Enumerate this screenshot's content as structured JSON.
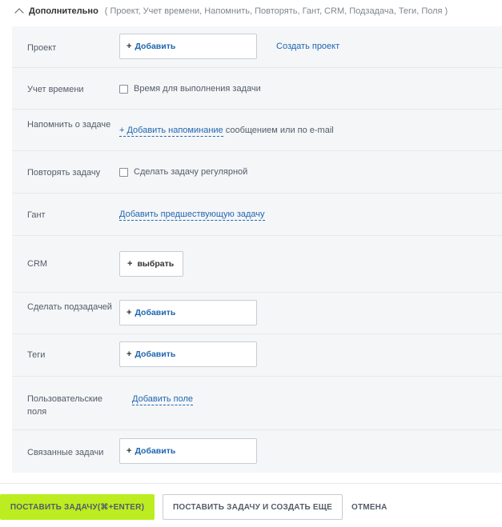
{
  "header": {
    "title": "Дополнительно",
    "fields_list": "( Проект,  Учет времени,  Напомнить,  Повторять,  Гант,  CRM,  Подзадача,  Теги,  Поля )"
  },
  "rows": {
    "project": {
      "label": "Проект",
      "add_label": "Добавить",
      "create_link": "Создать проект"
    },
    "time_tracking": {
      "label": "Учет времени",
      "checkbox_label": "Время для выполнения задачи"
    },
    "remind": {
      "label": "Напомнить о задаче",
      "link": "+ Добавить напоминание",
      "suffix": "сообщением или по e-mail"
    },
    "repeat": {
      "label": "Повторять задачу",
      "checkbox_label": "Сделать задачу регулярной"
    },
    "gantt": {
      "label": "Гант",
      "link": "Добавить предшествующую задачу"
    },
    "crm": {
      "label": "CRM",
      "button_label": "выбрать"
    },
    "subtask": {
      "label": "Сделать подзадачей",
      "add_label": "Добавить"
    },
    "tags": {
      "label": "Теги",
      "add_label": "Добавить"
    },
    "custom_fields": {
      "label": "Пользовательские поля",
      "link": "Добавить поле"
    },
    "related": {
      "label": "Связанные задачи",
      "add_label": "Добавить"
    }
  },
  "footer": {
    "submit": "ПОСТАВИТЬ ЗАДАЧУ(⌘+ENTER)",
    "submit_and_new": "ПОСТАВИТЬ ЗАДАЧУ И СОЗДАТЬ ЕЩЕ",
    "cancel": "ОТМЕНА"
  },
  "colors": {
    "accent_green": "#bbed21",
    "link_blue": "#2067b0",
    "panel_bg": "#f5f6f8"
  }
}
